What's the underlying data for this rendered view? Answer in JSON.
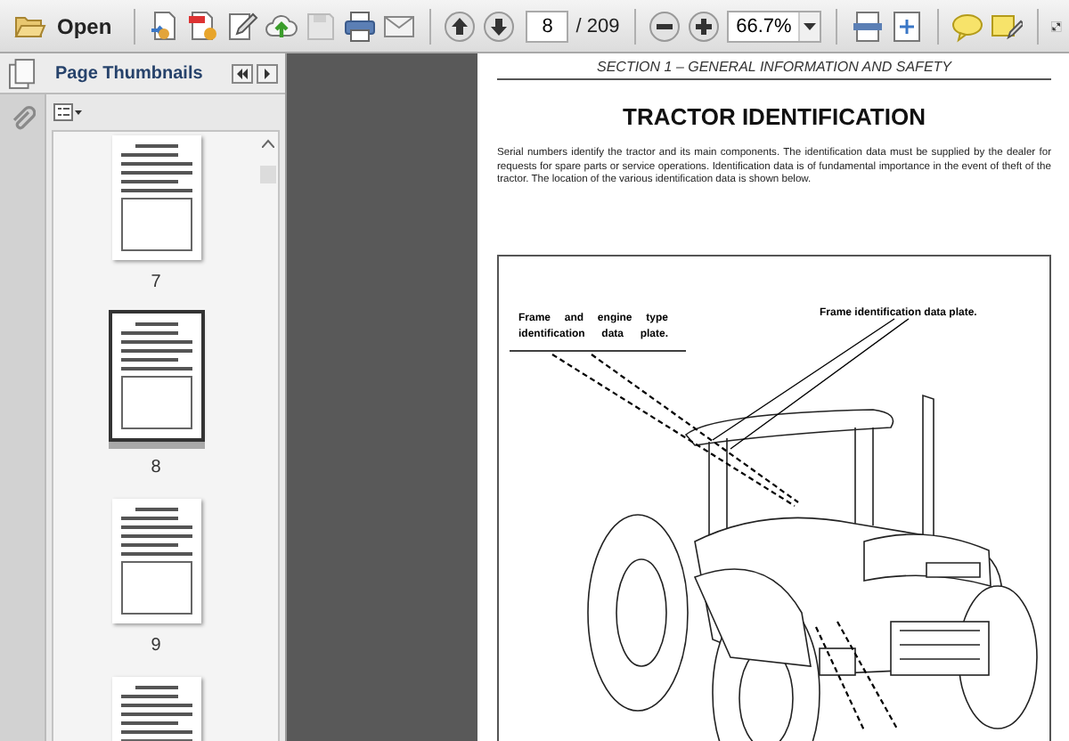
{
  "toolbar": {
    "open_label": "Open",
    "page_number": "8",
    "page_total": "/ 209",
    "zoom": "66.7%"
  },
  "sidebar": {
    "title": "Page Thumbnails",
    "thumbnails": [
      {
        "label": "7",
        "selected": false
      },
      {
        "label": "8",
        "selected": true
      },
      {
        "label": "9",
        "selected": false
      },
      {
        "selected": false
      }
    ]
  },
  "document": {
    "header": "SECTION 1  – GENERAL INFORMATION AND SAFETY",
    "title": "TRACTOR IDENTIFICATION",
    "paragraph": "Serial numbers identify the tractor and its main components. The identification data must be supplied by the dealer for requests for spare parts or service operations. Identification data is of fundamental importance in the event of theft of the tractor. The location of the various identification data is shown below.",
    "callouts": [
      "Frame and engine type identification data plate.",
      "Frame identification data plate."
    ]
  }
}
